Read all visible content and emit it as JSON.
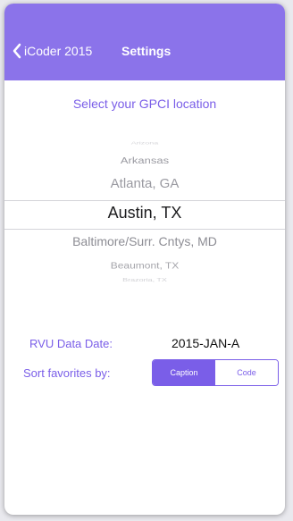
{
  "navbar": {
    "back_label": "iCoder 2015",
    "title": "Settings",
    "color": "#8b73ea"
  },
  "location": {
    "prompt": "Select your GPCI location",
    "items": [
      "Arizona",
      "Arkansas",
      "Atlanta, GA",
      "Austin, TX",
      "Baltimore/Surr. Cntys, MD",
      "Beaumont, TX",
      "Brazoria, TX"
    ],
    "selected": "Austin, TX"
  },
  "rvu": {
    "label": "RVU Data Date:",
    "value": "2015-JAN-A"
  },
  "sort": {
    "label": "Sort favorites by:",
    "options": [
      "Caption",
      "Code"
    ],
    "selected": "Caption"
  },
  "accent_color": "#7a5ee8"
}
